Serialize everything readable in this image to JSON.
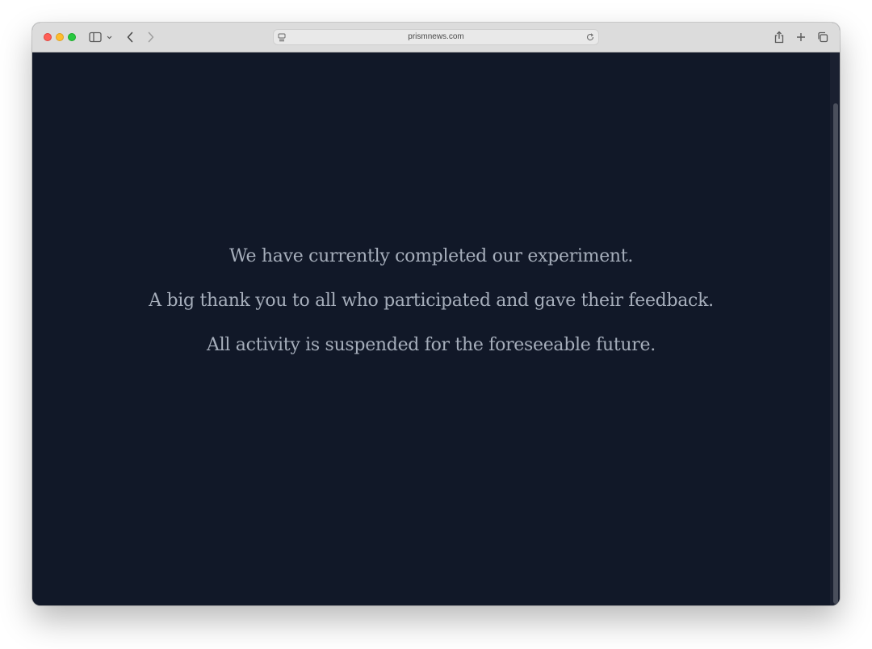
{
  "browser": {
    "url": "prismnews.com",
    "icons": {
      "sidebar": "sidebar-icon",
      "back": "chevron-left-icon",
      "forward": "chevron-right-icon",
      "reload": "reload-icon",
      "share": "share-icon",
      "new_tab": "plus-icon",
      "tab_overview": "tabs-icon"
    }
  },
  "page": {
    "background_color": "#111828",
    "text_color": "#a6aebb",
    "lines": [
      "We have currently completed our experiment.",
      "A big thank you to all who participated and gave their feedback.",
      "All activity is suspended for the foreseeable future."
    ]
  }
}
